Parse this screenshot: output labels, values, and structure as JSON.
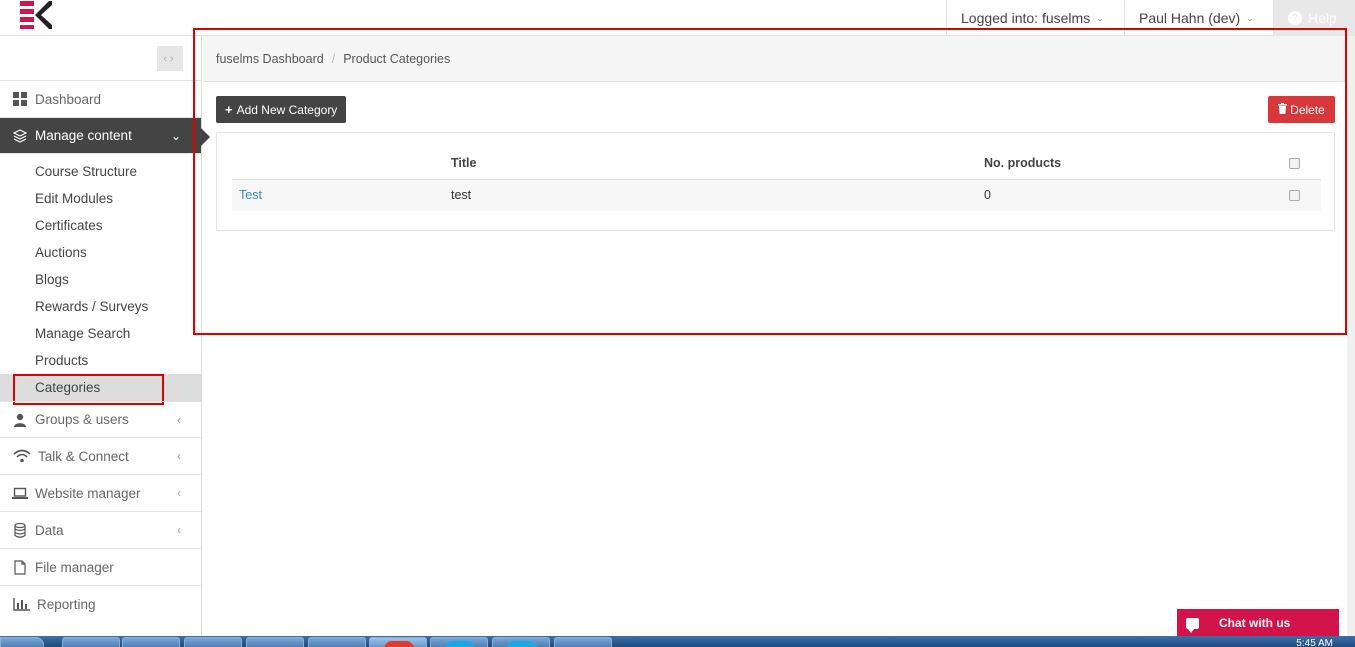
{
  "topbar": {
    "login_label": "Logged into: fuselms",
    "user_label": "Paul Hahn (dev)",
    "help_label": "Help"
  },
  "sidebar": {
    "items": [
      {
        "label": "Dashboard",
        "icon": "grid-icon"
      },
      {
        "label": "Manage content",
        "icon": "layers-icon",
        "active": true
      },
      {
        "label": "Groups & users",
        "icon": "user-icon"
      },
      {
        "label": "Talk & Connect",
        "icon": "wifi-icon"
      },
      {
        "label": "Website manager",
        "icon": "laptop-icon"
      },
      {
        "label": "Data",
        "icon": "database-icon"
      },
      {
        "label": "File manager",
        "icon": "file-icon"
      },
      {
        "label": "Reporting",
        "icon": "bar-chart-icon"
      }
    ],
    "sub_items": [
      "Course Structure",
      "Edit Modules",
      "Certificates",
      "Auctions",
      "Blogs",
      "Rewards / Surveys",
      "Manage Search",
      "Products",
      "Categories"
    ],
    "current_sub": "Categories"
  },
  "breadcrumb": {
    "root": "fuselms Dashboard",
    "current": "Product Categories"
  },
  "actions": {
    "add_label": "Add New Category",
    "delete_label": "Delete"
  },
  "table": {
    "headers": {
      "title": "Title",
      "count": "No. products"
    },
    "rows": [
      {
        "name": "Test",
        "title": "test",
        "count": "0"
      }
    ]
  },
  "chat": {
    "label": "Chat with us"
  },
  "taskbar": {
    "clock": "5:45 AM"
  },
  "colors": {
    "dark": "#444444",
    "danger": "#d9383a",
    "link": "#3a87c8",
    "chat": "#d2144a",
    "highlight": "#e00000"
  }
}
